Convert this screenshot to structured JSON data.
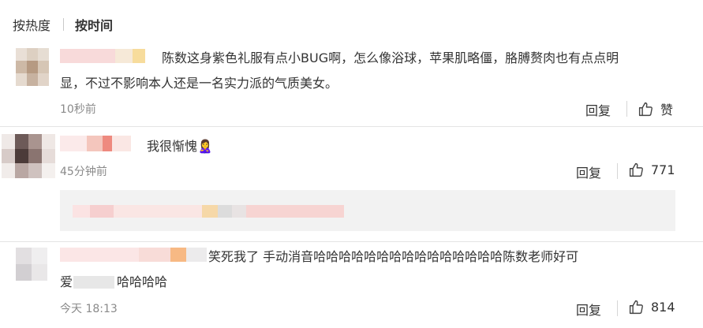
{
  "sort_bar": {
    "by_hot": "按热度",
    "by_time": "按时间"
  },
  "comments": [
    {
      "text_line1": "陈数这身紫色礼服有点小BUG啊，怎么像浴球，苹果肌略僵，胳膊赘肉也有点点明",
      "text_line2": "显，不过不影响本人还是一名实力派的气质美女。",
      "time": "10秒前",
      "reply_label": "回复",
      "like_label": "赞"
    },
    {
      "text": "我很惭愧🙎‍♀️",
      "time": "45分钟前",
      "reply_label": "回复",
      "like_count": "771"
    },
    {
      "text_line1": "笑死我了 手动消音哈哈哈哈哈哈哈哈哈哈哈哈哈哈哈陈数老师好可",
      "text_line2_prefix": "爱",
      "text_line2_suffix": "哈哈哈哈",
      "time": "今天 18:13",
      "reply_label": "回复",
      "like_count": "814"
    }
  ],
  "icons": [
    "thumbs-up-icon"
  ],
  "colors": {
    "time_gray": "#8a8a8a",
    "divider": "#e4e4e4",
    "quote_bg": "#f2f2f2"
  }
}
